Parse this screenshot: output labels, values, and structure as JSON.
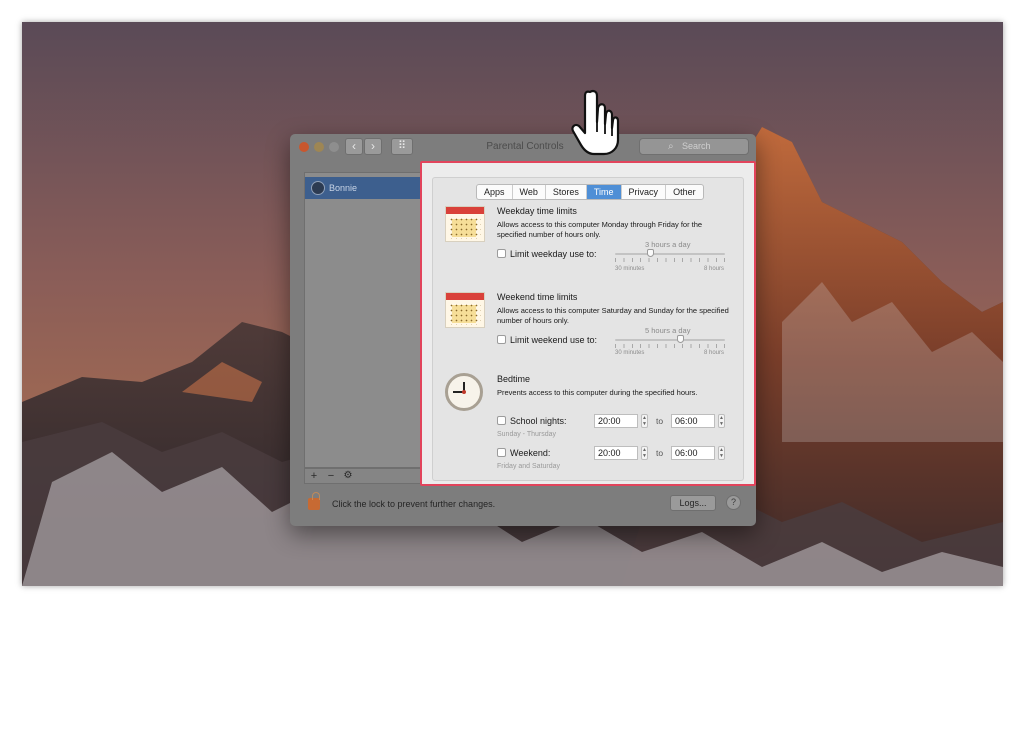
{
  "window": {
    "title": "Parental Controls",
    "search_placeholder": "Search",
    "lock_text": "Click the lock to prevent further changes.",
    "logs_button": "Logs...",
    "help_button": "?"
  },
  "sidebar": {
    "users": [
      {
        "name": "Bonnie"
      }
    ],
    "tools": {
      "add": "+",
      "remove": "−",
      "gear": "⚙"
    }
  },
  "tabs": [
    {
      "label": "Apps",
      "active": false
    },
    {
      "label": "Web",
      "active": false
    },
    {
      "label": "Stores",
      "active": false
    },
    {
      "label": "Time",
      "active": true
    },
    {
      "label": "Privacy",
      "active": false
    },
    {
      "label": "Other",
      "active": false
    }
  ],
  "weekday": {
    "title": "Weekday time limits",
    "desc": "Allows access to this computer Monday through Friday for the specified number of hours only.",
    "checkbox_label": "Limit weekday use to:",
    "value_label": "3 hours a day",
    "min_label": "30 minutes",
    "max_label": "8 hours",
    "level": 0.33
  },
  "weekend": {
    "title": "Weekend time limits",
    "desc": "Allows access to this computer Saturday and Sunday for the specified number of hours only.",
    "checkbox_label": "Limit weekend use to:",
    "value_label": "5 hours a day",
    "min_label": "30 minutes",
    "max_label": "8 hours",
    "level": 0.6
  },
  "bedtime": {
    "title": "Bedtime",
    "desc": "Prevents access to this computer during the specified hours.",
    "school_label": "School nights:",
    "school_sub": "Sunday - Thursday",
    "school_from": "20:00",
    "school_to": "06:00",
    "weekend_label": "Weekend:",
    "weekend_sub": "Friday and Saturday",
    "weekend_from": "20:00",
    "weekend_to": "06:00",
    "to_word": "to"
  },
  "icons": {
    "close": "close-button-icon",
    "back": "‹",
    "forward": "›",
    "grid": "⠿",
    "search": "search-icon",
    "lock": "lock-icon",
    "cursor": "pointing-hand-cursor-icon"
  },
  "colors": {
    "highlight_border": "#e2445c",
    "active_tab": "#4f8fd6",
    "selected_user": "#3d5f8e"
  }
}
